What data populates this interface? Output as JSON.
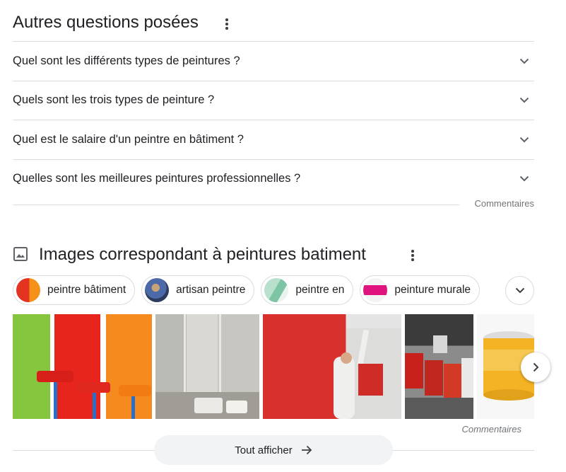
{
  "people_also_ask": {
    "title": "Autres questions posées",
    "questions": [
      "Quel sont les différents types de peintures ?",
      "Quels sont les trois types de peinture ?",
      "Quel est le salaire d'un peintre en bâtiment ?",
      "Quelles sont les meilleures peintures professionnelles ?"
    ],
    "feedback_label": "Commentaires"
  },
  "images_section": {
    "title": "Images correspondant à peintures batiment",
    "chips": [
      "peintre bâtiment",
      "artisan peintre",
      "peintre en",
      "peinture murale"
    ],
    "feedback_label": "Commentaires",
    "show_all_label": "Tout afficher"
  },
  "colors": {
    "text": "#202124",
    "muted": "#70757a",
    "divider": "#dadce0",
    "button_bg": "#f1f3f4"
  },
  "icons": [
    "more-vert-icon",
    "chevron-down-icon",
    "image-icon",
    "chevron-right-icon",
    "arrow-right-icon"
  ]
}
